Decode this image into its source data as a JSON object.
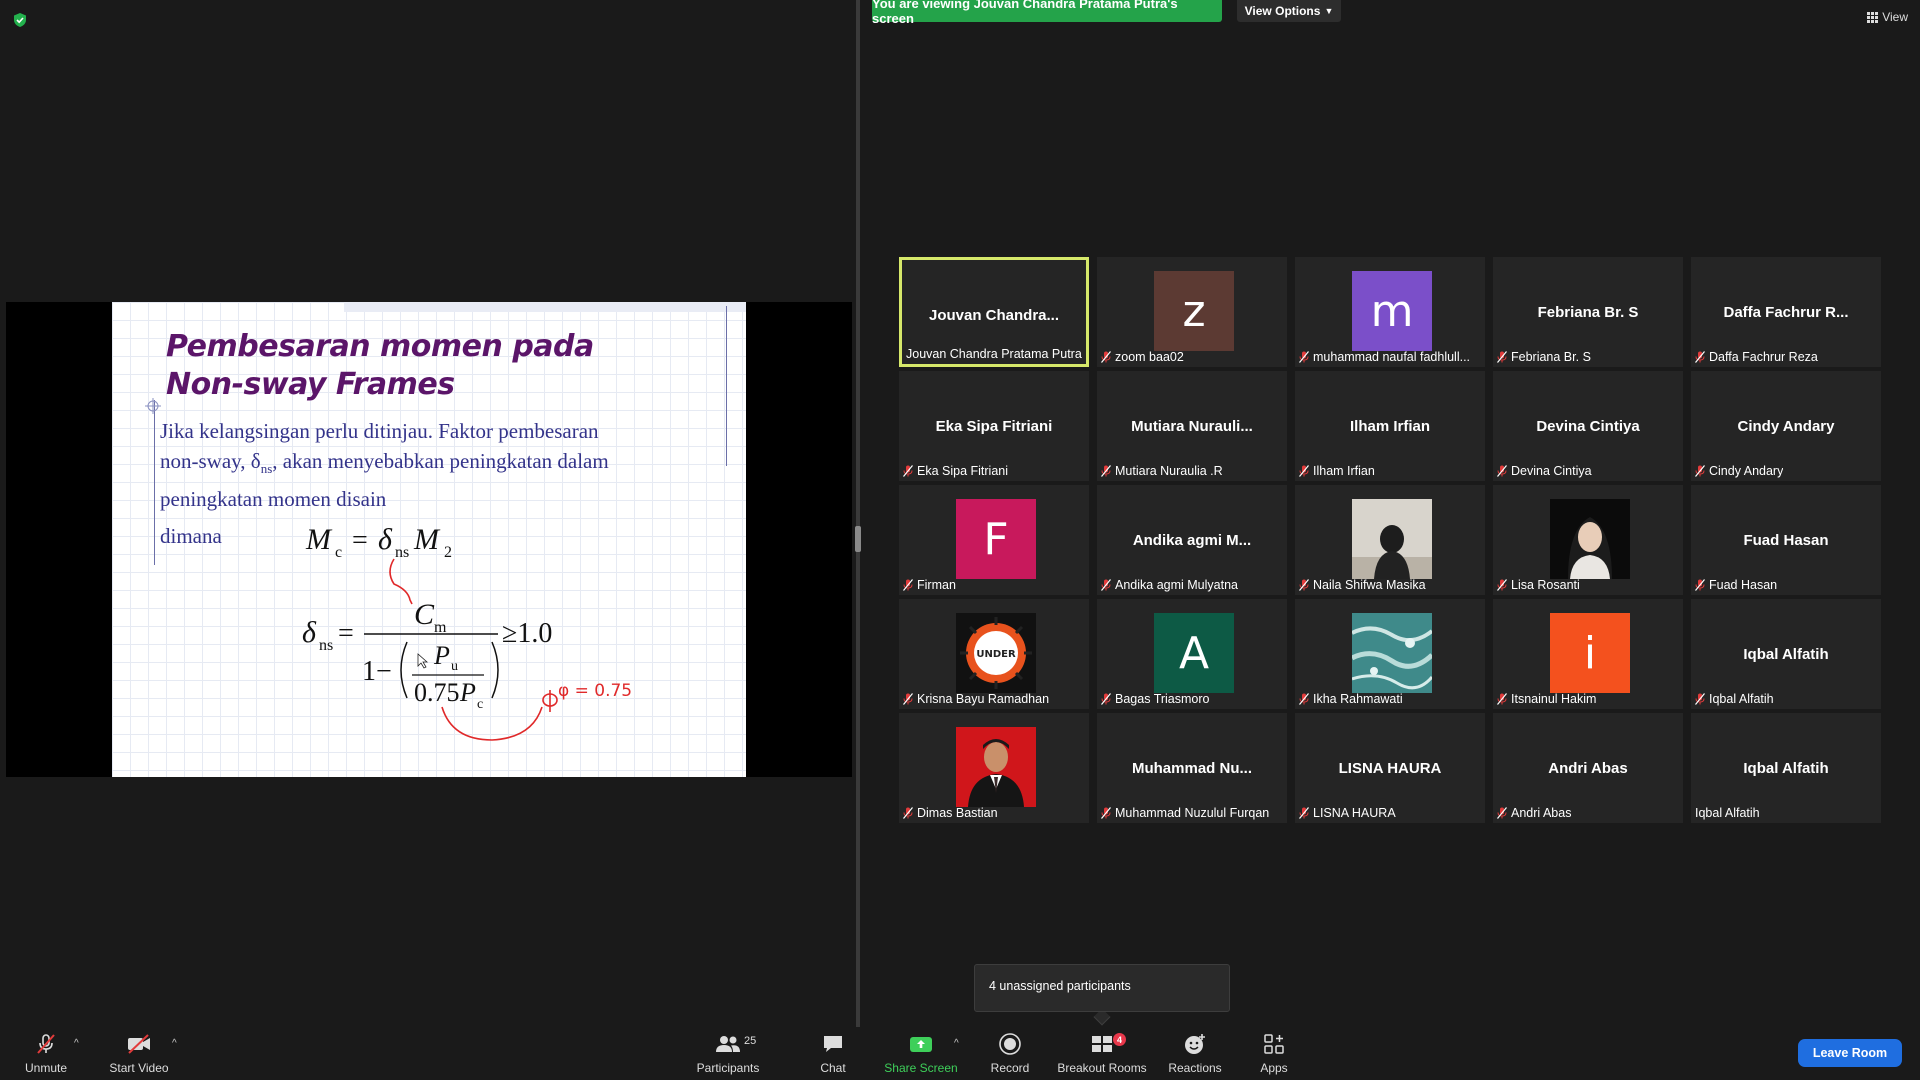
{
  "top": {
    "banner": "You are viewing Jouvan Chandra Pratama Putra's screen",
    "view_options": "View Options",
    "view": "View"
  },
  "slide": {
    "title_line1": "Pembesaran momen pada",
    "title_line2": "Non-sway Frames",
    "body": "Jika kelangsingan perlu ditinjau. Faktor pembesaran non-sway, δns, akan menyebabkan peningkatan dalam peningkatan momen disain",
    "body_part1": "Jika kelangsingan perlu ditinjau. Faktor pembesaran",
    "body_part2a": "non-sway, δ",
    "body_part2_sub": "ns",
    "body_part2b": ", akan menyebabkan peningkatan dalam",
    "body_part3": "peningkatan momen disain",
    "dimana": "dimana",
    "annotation": "φ = 0.75"
  },
  "participants": [
    {
      "center": "Jouvan  Chandra...",
      "label": "Jouvan Chandra Pratama Putra",
      "muted": false,
      "active": true
    },
    {
      "avatar": "z",
      "avatar_color": "#5c3a33",
      "label": "zoom baa02",
      "muted": true
    },
    {
      "avatar": "m",
      "avatar_color": "#7b4fc9",
      "label": "muhammad naufal fadhlull...",
      "muted": true
    },
    {
      "center": "Febriana Br. S",
      "label": "Febriana Br. S",
      "muted": true
    },
    {
      "center": "Daffa Fachrur R...",
      "label": "Daffa Fachrur Reza",
      "muted": true
    },
    {
      "center": "Eka Sipa Fitriani",
      "label": "Eka Sipa Fitriani",
      "muted": true
    },
    {
      "center": "Mutiara  Nurauli...",
      "label": "Mutiara Nuraulia .R",
      "muted": true
    },
    {
      "center": "Ilham Irfian",
      "label": "Ilham Irfian",
      "muted": true
    },
    {
      "center": "Devina Cintiya",
      "label": "Devina Cintiya",
      "muted": true
    },
    {
      "center": "Cindy Andary",
      "label": "Cindy Andary",
      "muted": true
    },
    {
      "avatar": "F",
      "avatar_color": "#c8195c",
      "label": "Firman",
      "muted": true
    },
    {
      "center": "Andika  agmi  M...",
      "label": "Andika agmi Mulyatna",
      "muted": true
    },
    {
      "photo": "naila",
      "label": "Naila Shifwa Masika",
      "muted": true
    },
    {
      "photo": "lisa",
      "label": "Lisa Rosanti",
      "muted": true
    },
    {
      "center": "Fuad Hasan",
      "label": "Fuad Hasan",
      "muted": true
    },
    {
      "photo": "under",
      "photo_text": "UNDER",
      "label": "Krisna Bayu Ramadhan",
      "muted": true
    },
    {
      "avatar": "A",
      "avatar_color": "#0d5a45",
      "label": "Bagas Triasmoro",
      "muted": true
    },
    {
      "photo": "water",
      "label": "Ikha Rahmawati",
      "muted": true
    },
    {
      "avatar": "i",
      "avatar_color": "#f4511e",
      "label": "Itsnainul Hakim",
      "muted": true
    },
    {
      "center": "Iqbal Alfatih",
      "label": "Iqbal Alfatih",
      "muted": true
    },
    {
      "photo": "dimas",
      "label": "Dimas Bastian",
      "muted": true
    },
    {
      "center": "Muhammad  Nu...",
      "label": "Muhammad Nuzulul Furqan",
      "muted": true
    },
    {
      "center": "LISNA HAURA",
      "label": "LISNA HAURA",
      "muted": true
    },
    {
      "center": "Andri Abas",
      "label": "Andri Abas",
      "muted": true
    },
    {
      "center": "Iqbal Alfatih",
      "label": "Iqbal Alfatih",
      "muted": false
    }
  ],
  "popup": "4 unassigned participants",
  "toolbar": {
    "unmute": "Unmute",
    "start_video": "Start Video",
    "participants": "Participants",
    "participants_count": "25",
    "chat": "Chat",
    "share_screen": "Share Screen",
    "record": "Record",
    "breakout_rooms": "Breakout Rooms",
    "breakout_badge": "4",
    "reactions": "Reactions",
    "apps": "Apps",
    "leave_room": "Leave Room"
  },
  "colors": {
    "banner": "#24a34a",
    "active_border": "#d6e86a",
    "leave": "#1f6ee0",
    "share_green": "#3ecf5a",
    "mute_red": "#e23b3b",
    "slide_title": "#5b1569",
    "slide_text": "#33338a",
    "annotation_red": "#e0292a"
  }
}
